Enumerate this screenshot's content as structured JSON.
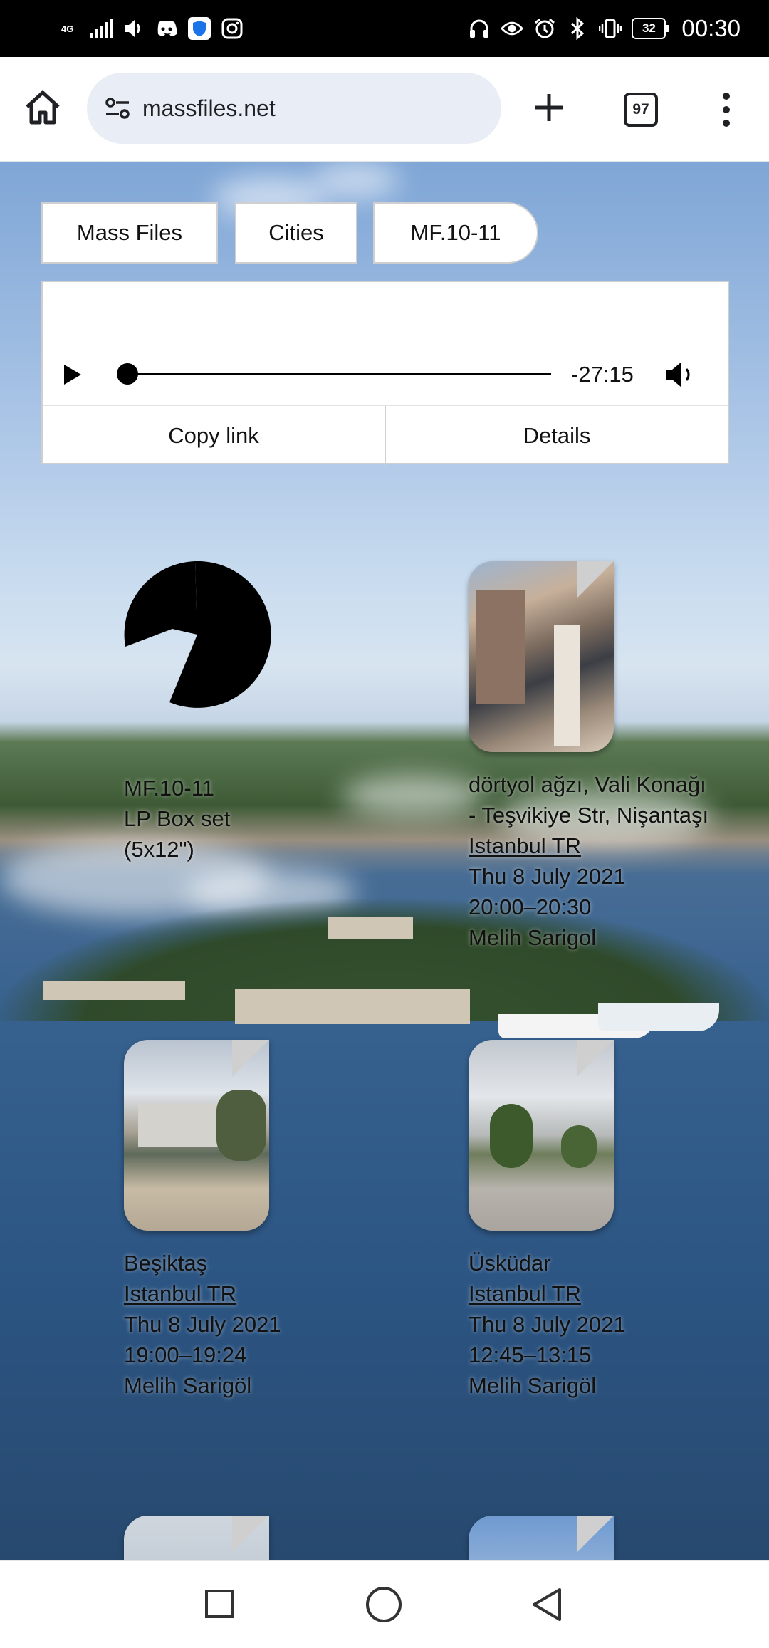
{
  "status_bar": {
    "network": "4G",
    "battery": "32",
    "time": "00:30",
    "icons_left": [
      "signal-icon",
      "volume-icon",
      "discord-icon",
      "shield-icon",
      "instagram-icon"
    ],
    "icons_right": [
      "headphones-icon",
      "eye-icon",
      "alarm-icon",
      "bluetooth-icon",
      "vibrate-icon",
      "battery-icon"
    ]
  },
  "browser": {
    "url": "massfiles.net",
    "tab_count": "97"
  },
  "nav_tabs": [
    {
      "label": "Mass Files"
    },
    {
      "label": "Cities"
    },
    {
      "label": "MF.10-11"
    }
  ],
  "player": {
    "time_remaining": "-27:15",
    "progress": 0.0,
    "copy_link_label": "Copy link",
    "details_label": "Details"
  },
  "items": [
    {
      "type": "release",
      "lines": [
        "MF.10-11",
        "LP Box set",
        "(5x12\")"
      ]
    },
    {
      "type": "recording",
      "title_lines": [
        "dörtyol ağzı, Vali Konağı",
        "- Teşvikiye Str, Nişantaşı"
      ],
      "city": "Istanbul TR",
      "date": "Thu 8 July 2021",
      "time": "20:00–20:30",
      "author": "Melih Sarigol"
    },
    {
      "type": "recording",
      "title_lines": [
        "Beşiktaş"
      ],
      "city": "Istanbul TR",
      "date": "Thu 8 July 2021",
      "time": "19:00–19:24",
      "author": "Melih Sarigöl"
    },
    {
      "type": "recording",
      "title_lines": [
        "Üsküdar"
      ],
      "city": "Istanbul TR",
      "date": "Thu 8 July 2021",
      "time": "12:45–13:15",
      "author": "Melih Sarigöl"
    }
  ],
  "colors": {
    "accent": "#000000",
    "browser_url_bg": "#e9edf6"
  }
}
